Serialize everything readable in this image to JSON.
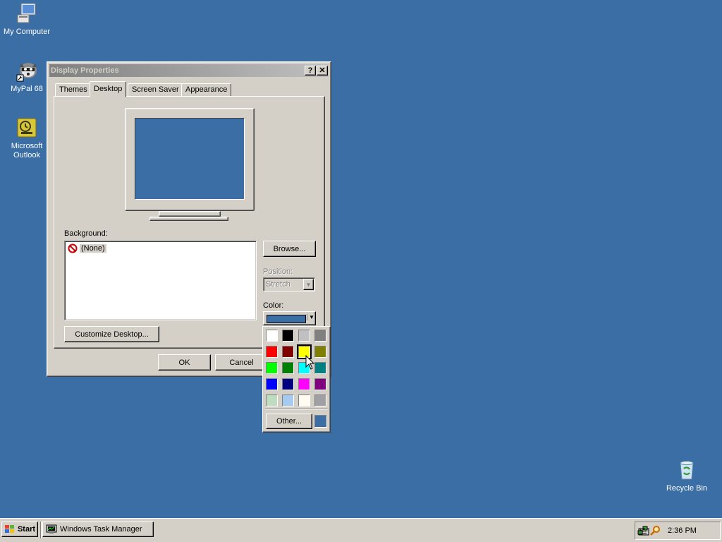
{
  "desktop": {
    "background_color": "#3a6ea5",
    "icons": [
      {
        "label": "My Computer",
        "icon": "computer-icon"
      },
      {
        "label": "MyPal 68",
        "icon": "raccoon-shortcut-icon"
      },
      {
        "label": "Microsoft Outlook",
        "icon": "outlook-icon"
      },
      {
        "label": "Recycle Bin",
        "icon": "recycle-bin-icon"
      }
    ]
  },
  "dialog": {
    "title": "Display Properties",
    "help_button": "?",
    "close_button": "✕",
    "tabs": [
      {
        "label": "Themes",
        "active": false
      },
      {
        "label": "Desktop",
        "active": true
      },
      {
        "label": "Screen Saver",
        "active": false
      },
      {
        "label": "Appearance",
        "active": false
      }
    ],
    "preview_color": "#3a6ea5",
    "background": {
      "label": "Background:",
      "items": [
        {
          "label": "(None)",
          "icon": "none-icon",
          "selected": true
        }
      ]
    },
    "browse_button": "Browse...",
    "position": {
      "label": "Position:",
      "value": "Stretch",
      "disabled": true
    },
    "color": {
      "label": "Color:",
      "value": "#3a6ea5"
    },
    "customize_button": "Customize Desktop...",
    "ok_button": "OK",
    "cancel_button": "Cancel"
  },
  "color_picker": {
    "swatches": [
      [
        "#ffffff",
        "#000000",
        "#c0c0c0",
        "#808080"
      ],
      [
        "#ff0000",
        "#800000",
        "#ffff00",
        "#808000"
      ],
      [
        "#00ff00",
        "#008000",
        "#00ffff",
        "#008080"
      ],
      [
        "#0000ff",
        "#000080",
        "#ff00ff",
        "#800080"
      ],
      [
        "#c0dcc0",
        "#a6caf0",
        "#fffbf0",
        "#a0a0a4"
      ]
    ],
    "highlighted": "#ffff00",
    "other_button": "Other...",
    "current_color": "#3a6ea5"
  },
  "taskbar": {
    "start_label": "Start",
    "tasks": [
      {
        "label": "Windows Task Manager",
        "icon": "task-manager-icon"
      }
    ],
    "tray_icons": [
      "keyboard-icon",
      "network-icon",
      "search-icon"
    ],
    "clock": "2:36 PM"
  }
}
